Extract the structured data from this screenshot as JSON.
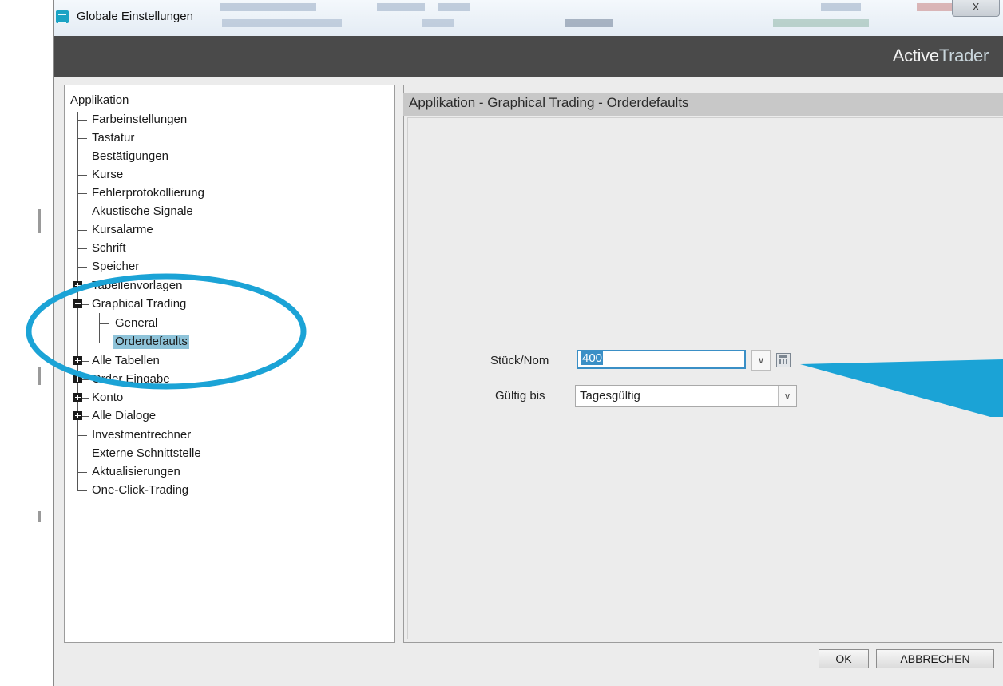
{
  "window": {
    "title": "Globale Einstellungen",
    "close_label": "X"
  },
  "header": {
    "brand_a": "Active",
    "brand_b": "Trader"
  },
  "tree": {
    "root": "Applikation",
    "items": [
      "Farbeinstellungen",
      "Tastatur",
      "Bestätigungen",
      "Kurse",
      "Fehlerprotokollierung",
      "Akustische Signale",
      "Kursalarme",
      "Schrift",
      "Speicher",
      "Tabellenvorlagen",
      "Graphical Trading",
      "General",
      "Orderdefaults",
      "Alle Tabellen",
      "Order Eingabe",
      "Konto",
      "Alle Dialoge",
      "Investmentrechner",
      "Externe Schnittstelle",
      "Aktualisierungen",
      "One-Click-Trading"
    ]
  },
  "panel": {
    "title": "Applikation - Graphical Trading - Orderdefaults",
    "qty_label": "Stück/Nom",
    "qty_value": "400",
    "validity_label": "Gültig bis",
    "validity_value": "Tagesgültig"
  },
  "buttons": {
    "ok": "OK",
    "cancel": "ABBRECHEN"
  },
  "annotation": {
    "color": "#1ba3d6"
  }
}
